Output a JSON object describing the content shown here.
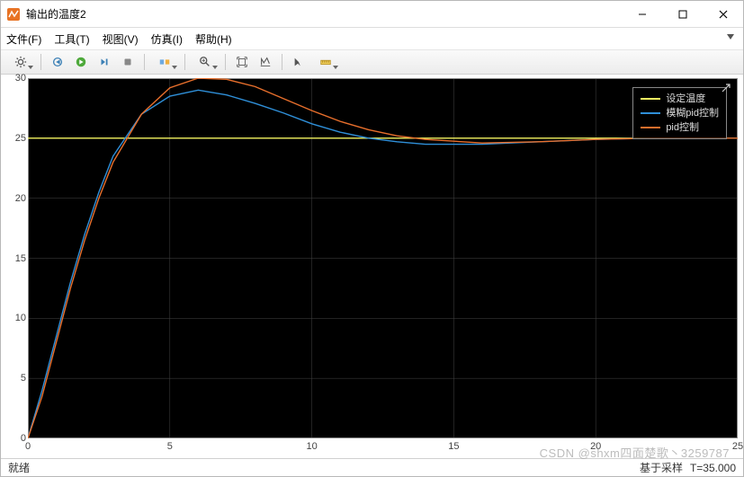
{
  "window": {
    "title": "输出的温度2"
  },
  "menu": {
    "file": "文件(F)",
    "tools": "工具(T)",
    "view": "视图(V)",
    "simulate": "仿真(I)",
    "help": "帮助(H)"
  },
  "toolbar": {
    "icons": {
      "settings": "gear",
      "run_back": "run-back",
      "run": "run",
      "step_fwd": "step-fwd",
      "stop": "stop",
      "highlight": "highlight",
      "zoom": "zoom",
      "pan": "pan",
      "scalexy": "scalexy",
      "cursor": "cursor",
      "measure": "measure"
    }
  },
  "status": {
    "left": "就绪",
    "right_label": "基于采样",
    "right_value": "T=35.000"
  },
  "watermark": "CSDN @shxm四面楚歌丶3259787",
  "legend": {
    "items": [
      {
        "label": "设定温度",
        "color": "#f5f561"
      },
      {
        "label": "模糊pid控制",
        "color": "#2f8fd8"
      },
      {
        "label": "pid控制",
        "color": "#e86f2c"
      }
    ]
  },
  "chart_data": {
    "type": "line",
    "xlabel": "",
    "ylabel": "",
    "xlim": [
      0,
      25
    ],
    "ylim": [
      0,
      30
    ],
    "xticks": [
      0,
      5,
      10,
      15,
      20,
      25
    ],
    "yticks": [
      0,
      5,
      10,
      15,
      20,
      25,
      30
    ],
    "grid": true,
    "series": [
      {
        "name": "设定温度",
        "color": "#f5f561",
        "x": [
          0,
          25
        ],
        "y": [
          25,
          25
        ]
      },
      {
        "name": "模糊pid控制",
        "color": "#2f8fd8",
        "x": [
          0,
          0.5,
          1,
          1.5,
          2,
          2.5,
          3,
          4,
          5,
          6,
          7,
          8,
          9,
          10,
          11,
          12,
          13,
          14,
          16,
          18,
          20,
          22,
          25
        ],
        "y": [
          0,
          4,
          8.5,
          13,
          17,
          20.5,
          23.5,
          27,
          28.5,
          29,
          28.6,
          27.9,
          27.1,
          26.2,
          25.5,
          25.0,
          24.7,
          24.5,
          24.5,
          24.7,
          24.9,
          25.0,
          25.0
        ]
      },
      {
        "name": "pid控制",
        "color": "#e86f2c",
        "x": [
          0,
          0.5,
          1,
          1.5,
          2,
          2.5,
          3,
          4,
          5,
          6,
          7,
          8,
          9,
          10,
          11,
          12,
          13,
          14,
          16,
          18,
          20,
          22,
          25
        ],
        "y": [
          0,
          3.5,
          8,
          12.5,
          16.5,
          20,
          23,
          27,
          29.2,
          30,
          29.9,
          29.3,
          28.3,
          27.3,
          26.4,
          25.7,
          25.2,
          24.9,
          24.6,
          24.7,
          24.9,
          25.0,
          25.0
        ]
      }
    ]
  }
}
